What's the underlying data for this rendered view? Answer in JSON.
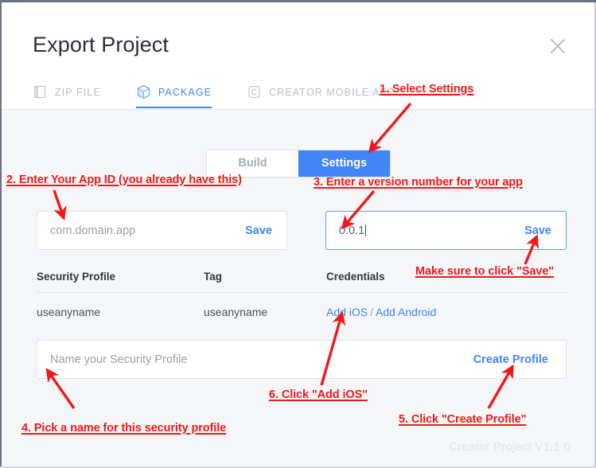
{
  "dialog": {
    "title": "Export Project",
    "close_icon": "close-icon",
    "watermark": "Creator Project V1.1.0"
  },
  "tabs": [
    {
      "label": "ZIP FILE",
      "icon": "zip-file-icon",
      "active": false
    },
    {
      "label": "PACKAGE",
      "icon": "package-cube-icon",
      "active": true
    },
    {
      "label": "CREATOR MOBILE APP",
      "icon": "mobile-app-icon",
      "active": false
    }
  ],
  "segmented": {
    "build_label": "Build",
    "settings_label": "Settings",
    "active": "Settings",
    "active_color": "#4285f4"
  },
  "fields": {
    "app_id": {
      "placeholder": "com.domain.app",
      "value": "",
      "action_label": "Save",
      "focused": false
    },
    "version": {
      "placeholder": "",
      "value": "0.0.1",
      "action_label": "Save",
      "focused": true
    },
    "profile_name": {
      "placeholder": "Name your Security Profile",
      "value": "",
      "action_label": "Create Profile",
      "focused": false
    }
  },
  "table": {
    "headers": [
      "Security Profile",
      "Tag",
      "Credentials"
    ],
    "rows": [
      {
        "security_profile": "useanyname",
        "tag": "useanyname",
        "credentials": {
          "add_ios": "Add iOS",
          "separator": "/",
          "add_android": "Add Android"
        }
      }
    ]
  },
  "annotations": {
    "color": "#f01818",
    "items": [
      {
        "id": "a1",
        "text": "1. Select Settings"
      },
      {
        "id": "a2",
        "text": "2. Enter Your App ID (you already have this)"
      },
      {
        "id": "a3",
        "text": "3. Enter a version number for your app"
      },
      {
        "id": "a4",
        "text": "Make sure to click \"Save\""
      },
      {
        "id": "a5",
        "text": "6. Click \"Add iOS\""
      },
      {
        "id": "a6",
        "text": "5. Click \"Create Profile\""
      },
      {
        "id": "a7",
        "text": "4. Pick a name for this security profile"
      }
    ]
  }
}
